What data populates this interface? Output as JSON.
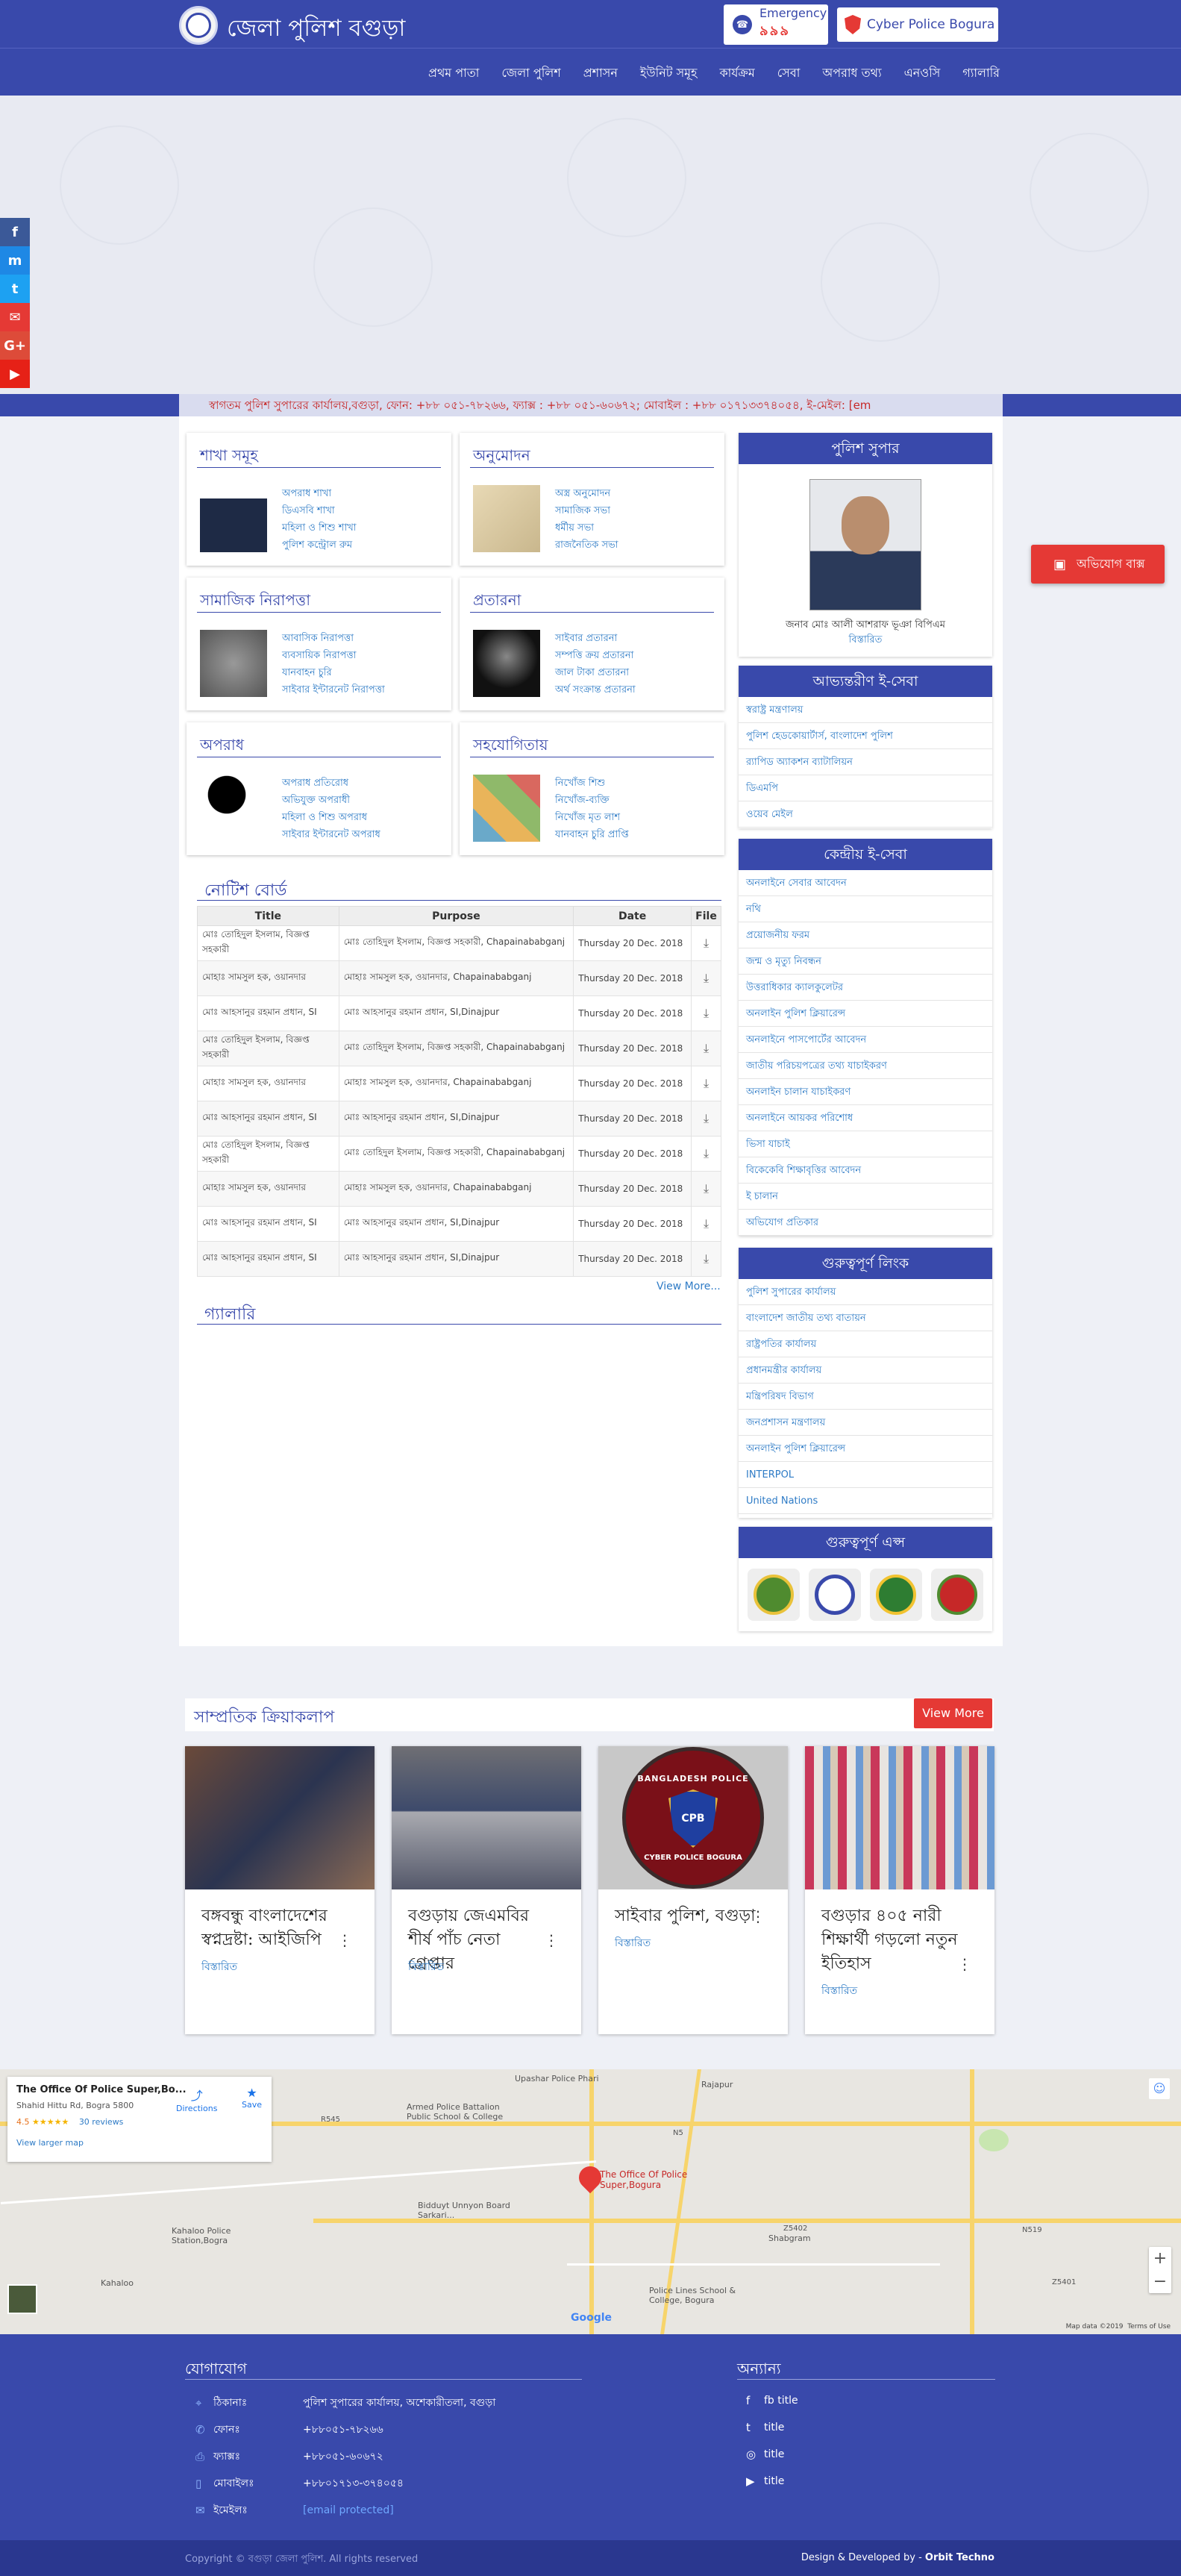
{
  "header": {
    "site_title": "জেলা পুলিশ বগুড়া",
    "emergency_label": "Emergency",
    "emergency_number": "৯৯৯",
    "cyber_label": "Cyber Police Bogura"
  },
  "nav": [
    "প্রথম পাতা",
    "জেলা পুলিশ",
    "প্রশাসন",
    "ইউনিট সমূহ",
    "কার্যক্রম",
    "সেবা",
    "অপরাধ তথ্য",
    "এনওসি",
    "গ্যালারি"
  ],
  "ticker": "স্বাগতম পুলিশ সুপারের কার্যালয়,বগুড়া, ফোন: +৮৮ ০৫১-৭৮২৬৬, ফ্যাক্স : +৮৮ ০৫১-৬০৬৭২; মোবাইল : +৮৮ ০১৭১৩৩৭৪০৫৪, ই-মেইল: [em",
  "cards": [
    {
      "title": "শাখা সমূহ",
      "items": [
        "অপরাধ শাখা",
        "ডিএসবি শাখা",
        "মহিলা ও শিশু শাখা",
        "পুলিশ কন্ট্রোল রুম"
      ]
    },
    {
      "title": "অনুমোদন",
      "items": [
        "অস্ত্র অনুমোদন",
        "সামাজিক সভা",
        "ধর্মীয় সভা",
        "রাজনৈতিক সভা"
      ]
    },
    {
      "title": "সামাজিক নিরাপত্তা",
      "items": [
        "আবাসিক নিরাপত্তা",
        "ব্যবসায়িক নিরাপত্তা",
        "যানবাহন চুরি",
        "সাইবার ইন্টারনেট নিরাপত্তা"
      ]
    },
    {
      "title": "প্রতারনা",
      "items": [
        "সাইবার প্রতারনা",
        "সম্পত্তি ক্রয় প্রতারনা",
        "জাল টাকা প্রতারনা",
        "অর্থ সংক্রান্ত প্রতারনা"
      ]
    },
    {
      "title": "অপরাধ",
      "items": [
        "অপরাধ প্রতিরোধ",
        "অভিযুক্ত অপরাধী",
        "মহিলা ও শিশু অপরাধ",
        "সাইবার ইন্টারনেট অপরাধ"
      ]
    },
    {
      "title": "সহযোগিতায়",
      "items": [
        "নিখোঁজ শিশু",
        "নিখোঁজ-ব্যক্তি",
        "নিখোঁজ মৃত লাশ",
        "যানবাহন চুরি প্রাপ্তি"
      ]
    }
  ],
  "notice": {
    "title": "নোটিশ বোর্ড",
    "columns": [
      "Title",
      "Purpose",
      "Date",
      "File"
    ],
    "rows": [
      [
        "মোঃ তোহিদুল ইসলাম, বিজ্ঞপ্ত সহকারী",
        "মোঃ তোহিদুল ইসলাম, বিজ্ঞপ্ত সহকারী, Chapainababganj",
        "Thursday 20 Dec. 2018"
      ],
      [
        "মোহাঃ সামসুল হক, ওয়ানদার",
        "মোহাঃ সামসুল হক, ওয়ানদার, Chapainababganj",
        "Thursday 20 Dec. 2018"
      ],
      [
        "মোঃ আহসানুর রহমান প্রধান, SI",
        "মোঃ আহসানুর রহমান প্রধান, SI,Dinajpur",
        "Thursday 20 Dec. 2018"
      ],
      [
        "মোঃ তোহিদুল ইসলাম, বিজ্ঞপ্ত সহকারী",
        "মোঃ তোহিদুল ইসলাম, বিজ্ঞপ্ত সহকারী, Chapainababganj",
        "Thursday 20 Dec. 2018"
      ],
      [
        "মোহাঃ সামসুল হক, ওয়ানদার",
        "মোহাঃ সামসুল হক, ওয়ানদার, Chapainababganj",
        "Thursday 20 Dec. 2018"
      ],
      [
        "মোঃ আহসানুর রহমান প্রধান, SI",
        "মোঃ আহসানুর রহমান প্রধান, SI,Dinajpur",
        "Thursday 20 Dec. 2018"
      ],
      [
        "মোঃ তোহিদুল ইসলাম, বিজ্ঞপ্ত সহকারী",
        "মোঃ তোহিদুল ইসলাম, বিজ্ঞপ্ত সহকারী, Chapainababganj",
        "Thursday 20 Dec. 2018"
      ],
      [
        "মোহাঃ সামসুল হক, ওয়ানদার",
        "মোহাঃ সামসুল হক, ওয়ানদার, Chapainababganj",
        "Thursday 20 Dec. 2018"
      ],
      [
        "মোঃ আহসানুর রহমান প্রধান, SI",
        "মোঃ আহসানুর রহমান প্রধান, SI,Dinajpur",
        "Thursday 20 Dec. 2018"
      ],
      [
        "মোঃ আহসানুর রহমান প্রধান, SI",
        "মোঃ আহসানুর রহমান প্রধান, SI,Dinajpur",
        "Thursday 20 Dec. 2018"
      ]
    ],
    "view_more": "View More..."
  },
  "gallery_title": "গ্যালারি",
  "sp": {
    "head": "পুলিশ সুপার",
    "name": "জনাব মোঃ আলী আশরাফ ভূঞা বিপিএম",
    "detail": "বিস্তারিত"
  },
  "internal_eservice": {
    "head": "আভ্যন্তরীণ ই-সেবা",
    "links": [
      "স্বরাষ্ট্র মন্ত্রণালয়",
      "পুলিশ হেডকোয়ার্টার্স, বাংলাদেশ পুলিশ",
      "র‍্যাপিড অ্যাকশন ব্যাটালিয়ন",
      "ডিএমপি",
      "ওয়েব মেইল"
    ]
  },
  "central_eservice": {
    "head": "কেন্দ্রীয় ই-সেবা",
    "links": [
      "অনলাইনে সেবার আবেদন",
      "নথি",
      "প্রয়োজনীয় ফরম",
      "জন্ম ও মৃত্যু নিবন্ধন",
      "উত্তরাধিকার ক্যালকুলেটর",
      "অনলাইন পুলিশ ক্লিয়ারেন্স",
      "অনলাইনে পাসপোর্টের আবেদন",
      "জাতীয় পরিচয়পত্রের তথ্য যাচাইকরণ",
      "অনলাইন চালান যাচাইকরণ",
      "অনলাইনে আয়কর পরিশোধ",
      "ভিসা যাচাই",
      "বিকেকেবি শিক্ষাবৃত্তির আবেদন",
      "ই চালান",
      "অভিযোগ প্রতিকার"
    ]
  },
  "important_links": {
    "head": "গুরুত্বপূর্ণ লিংক",
    "links": [
      "পুলিশ সুপারের কার্যালয়",
      "বাংলাদেশ জাতীয় তথ্য বাতায়ন",
      "রাষ্ট্রপতির কার্যালয়",
      "প্রধানমন্ত্রীর কার্যালয়",
      "মন্ত্রিপরিষদ বিভাগ",
      "জনপ্রশাসন মন্ত্রণালয়",
      "অনলাইন পুলিশ ক্লিয়ারেন্স",
      "INTERPOL",
      "United Nations"
    ]
  },
  "important_apps": {
    "head": "গুরুত্বপূর্ণ এপ্স"
  },
  "chat_button": "অভিযোগ বাক্স",
  "activities": {
    "title": "সাম্প্রতিক ক্রিয়াকলাপ",
    "view_more": "View More",
    "items": [
      {
        "title": "বঙ্গবন্ধু বাংলাদেশের স্বপ্নদ্রষ্টা: আইজিপি",
        "more": "বিস্তারিত"
      },
      {
        "title": "বগুড়ায় জেএমবির শীর্ষ পাঁচ নেতা গ্রেপ্তার",
        "more": "বিস্তারিত"
      },
      {
        "title": "সাইবার পুলিশ, বগুড়া",
        "more": "বিস্তারিত"
      },
      {
        "title": "বগুড়ার ৪০৫ নারী শিক্ষার্থী গড়লো নতুন ইতিহাস",
        "more": "বিস্তারিত"
      }
    ],
    "cpb_top": "BANGLADESH POLICE",
    "cpb_mid": "CPB",
    "cpb_bottom": "CYBER POLICE BOGURA"
  },
  "map": {
    "place_name": "The Office Of Police Super,Bo...",
    "address": "Shahid Hittu Rd, Bogra 5800",
    "rating": "4.5",
    "stars": "★★★★★",
    "reviews": "30 reviews",
    "directions": "Directions",
    "save": "Save",
    "larger": "View larger map",
    "pin_label": "The Office Of Police Super,Bogura",
    "labels": [
      "Upashar Police Phari",
      "Armed Police Battalion Public School & College",
      "Rajapur",
      "Bidduyt Unnyon Board Sarkari...",
      "Kahaloo Police Station,Bogra",
      "Kahaloo",
      "Shabgram",
      "Police Lines School & College, Bogura",
      "N5",
      "Z5402",
      "Z5401",
      "R545",
      "N519"
    ],
    "footer_data": "Map data ©2019",
    "footer_terms": "Terms of Use",
    "google": "Google"
  },
  "footer": {
    "contact_title": "যোগাযোগ",
    "contact": [
      {
        "label": "ঠিকানাঃ",
        "value": "পুলিশ সুপারের কার্যালয়, অশেকারীতলা, বগুড়া"
      },
      {
        "label": "ফোনঃ",
        "value": "+৮৮০৫১-৭৮২৬৬"
      },
      {
        "label": "ফ্যাক্সঃ",
        "value": "+৮৮০৫১-৬০৬৭২"
      },
      {
        "label": "মোবাইলঃ",
        "value": "+৮৮০১৭১৩-৩৭৪০৫৪"
      },
      {
        "label": "ইমেইলঃ",
        "value": "[email protected]"
      }
    ],
    "other_title": "অন্যান্য",
    "other": [
      "fb title",
      "title",
      "title",
      "title"
    ],
    "copyright": "Copyright © বগুড়া জেলা পুলিশ. All rights reserved",
    "developed_prefix": "Design & Developed by - ",
    "developer": "Orbit Techno"
  },
  "colors": {
    "primary": "#3949ab",
    "accent": "#e53935",
    "link": "#2e7bc6"
  }
}
